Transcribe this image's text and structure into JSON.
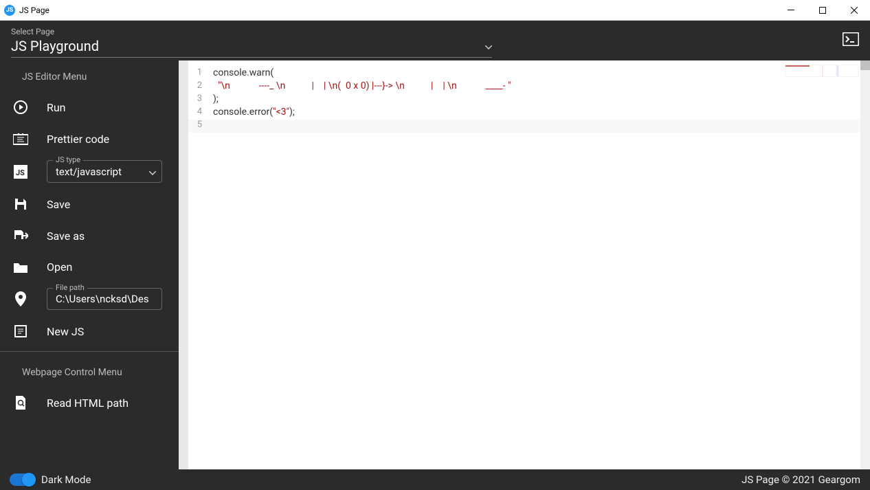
{
  "window": {
    "title": "JS Page"
  },
  "header": {
    "select_label": "Select Page",
    "select_value": "JS Playground"
  },
  "sidebar": {
    "section1_title": "JS Editor Menu",
    "items1": [
      {
        "label": "Run"
      },
      {
        "label": "Prettier code"
      }
    ],
    "js_type": {
      "legend": "JS type",
      "value": "text/javascript"
    },
    "items2": [
      {
        "label": "Save"
      },
      {
        "label": "Save as"
      },
      {
        "label": "Open"
      }
    ],
    "file_path": {
      "legend": "File path",
      "value": "C:\\Users\\ncksd\\Des"
    },
    "items3": [
      {
        "label": "New JS"
      }
    ],
    "section2_title": "Webpage Control Menu",
    "items4": [
      {
        "label": "Read HTML path"
      }
    ]
  },
  "editor": {
    "lines": [
      {
        "n": "1",
        "plain": "console.warn(",
        "str": ""
      },
      {
        "n": "2",
        "plain": "  ",
        "str": "\"\\n            ----_ \\n           |    | \\n(  0 x 0) |---}-> \\n           |    | \\n            ____- \""
      },
      {
        "n": "3",
        "plain": ");",
        "str": ""
      },
      {
        "n": "4",
        "plain": "console.error(",
        "str": "\"<3\"",
        "tail": ");"
      },
      {
        "n": "5",
        "plain": "",
        "str": ""
      }
    ]
  },
  "footer": {
    "dark_mode_label": "Dark Mode",
    "copyright": "JS Page © 2021 Geargom"
  }
}
